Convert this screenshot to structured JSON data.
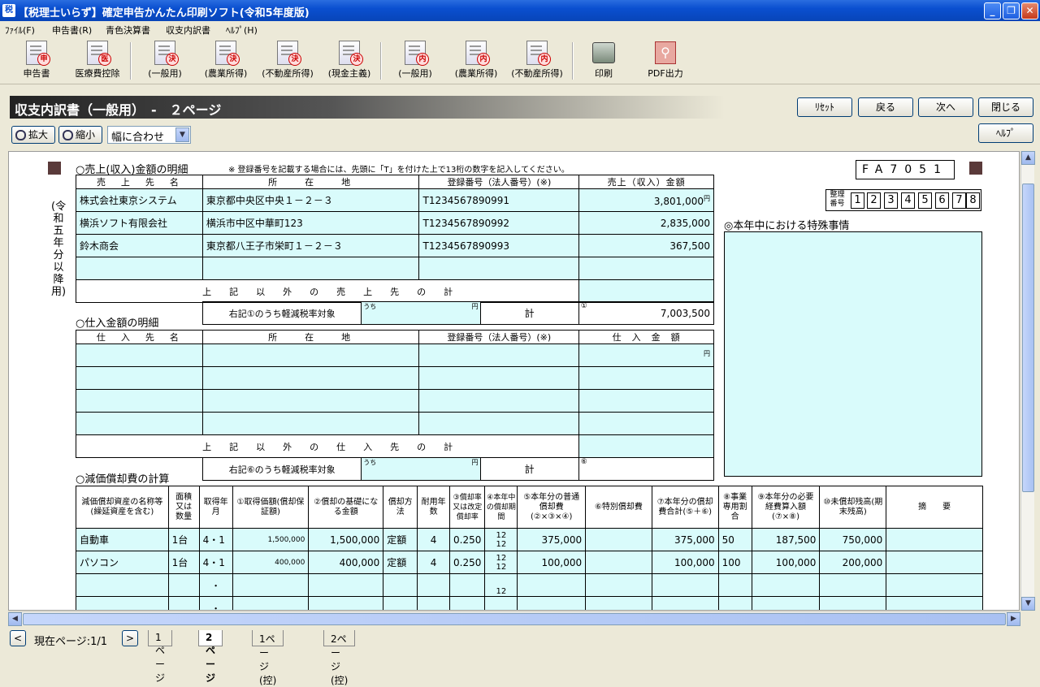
{
  "window": {
    "title": "【税理士いらず】確定申告かんたん印刷ソフト(令和5年度版)",
    "app_icon": "税",
    "minimize": "_",
    "maximize": "❐",
    "close": "✕"
  },
  "menu": [
    "ﾌｧｲﾙ(F)",
    "申告書(R)",
    "青色決算書",
    "収支内訳書",
    "ﾍﾙﾌﾟ(H)"
  ],
  "toolbar": {
    "shinkoku": {
      "label": "申告書",
      "stamp": "申"
    },
    "iryo": {
      "label": "医療費控除",
      "stamp": "医"
    },
    "ketsu_ippan": {
      "label": "(一般用)",
      "stamp": "決"
    },
    "ketsu_nogyo": {
      "label": "(農業所得)",
      "stamp": "決"
    },
    "ketsu_fudosan": {
      "label": "(不動産所得)",
      "stamp": "決"
    },
    "ketsu_genkin": {
      "label": "(現金主義)",
      "stamp": "決"
    },
    "uchi_ippan": {
      "label": "(一般用)",
      "stamp": "内"
    },
    "uchi_nogyo": {
      "label": "(農業所得)",
      "stamp": "内"
    },
    "uchi_fudosan": {
      "label": "(不動産所得)",
      "stamp": "内"
    },
    "print": {
      "label": "印刷"
    },
    "pdf": {
      "label": "PDF出力"
    }
  },
  "header": {
    "title": "収支内訳書（一般用）　-　２ページ"
  },
  "nav": {
    "reset": "ﾘｾｯﾄ",
    "prev": "戻る",
    "next": "次へ",
    "close": "閉じる",
    "help": "ﾍﾙﾌﾟ"
  },
  "zoom": {
    "in": "拡大",
    "out": "縮小",
    "fit": "幅に合わせ"
  },
  "form": {
    "code": "FA7051",
    "seiri_label": "整理番号",
    "seiri_digits": [
      "1",
      "2",
      "3",
      "4",
      "5",
      "6",
      "7",
      "8"
    ],
    "vertical_note": "(令和五年分以降用)",
    "sales": {
      "title": "○売上(収入)金額の明細",
      "note": "※ 登録番号を記載する場合には、先頭に「T」を付けた上で13桁の数字を記入してください。",
      "headers": [
        "売　上　先　名",
        "所　　在　　地",
        "登録番号（法人番号）(※)",
        "売上（収入）金額"
      ],
      "rows": [
        {
          "name": "株式会社東京システム",
          "address": "東京都中央区中央１－２－３",
          "reg": "T1234567890991",
          "amount": "3,801,000"
        },
        {
          "name": "横浜ソフト有限会社",
          "address": "横浜市中区中華町123",
          "reg": "T1234567890992",
          "amount": "2,835,000"
        },
        {
          "name": "鈴木商会",
          "address": "東京都八王子市栄町１－２－３",
          "reg": "T1234567890993",
          "amount": "367,500"
        }
      ],
      "other_label": "上　　記　　以　　外　　の　　売　　上　　先　　の　　計",
      "reduced_label": "右記①のうち軽減税率対象",
      "uchi": "うち",
      "yen": "円",
      "total_label": "計",
      "total_mark": "①",
      "total": "7,003,500"
    },
    "special": {
      "title": "◎本年中における特殊事情"
    },
    "purchase": {
      "title": "○仕入金額の明細",
      "headers": [
        "仕　入　先　名",
        "所　　在　　地",
        "登録番号（法人番号）(※)",
        "仕　入　金　額"
      ],
      "other_label": "上　　記　　以　　外　　の　　仕　　入　　先　　の　　計",
      "reduced_label": "右記⑥のうち軽減税率対象",
      "uchi": "うち",
      "yen": "円",
      "total_label": "計",
      "total_mark": "⑥"
    },
    "depreciation": {
      "title": "○減価償却費の計算",
      "headers": {
        "asset": "減価償却資産の名称等(繰延資産を含む)",
        "qty": "面積又は数量",
        "acq": "取得年月",
        "cost": "①取得価額(償却保証額)",
        "base": "②償却の基礎になる金額",
        "method": "償却方法",
        "life": "耐用年数",
        "rate": "③償却率又は改定償却率",
        "period": "④本年中の償却期間",
        "normal": "⑤本年分の普通償却費(②×③×④)",
        "special": "⑥特別償却費",
        "total": "⑦本年分の償却費合計(⑤＋⑥)",
        "biz": "⑧事業専用割合",
        "expense": "⑨本年分の必要経費算入額(⑦×⑧)",
        "remain": "⑩未償却残高(期末残高)",
        "memo": "摘　　要"
      },
      "rows": [
        {
          "asset": "自動車",
          "qty": "1台",
          "acq": "4・1",
          "cost": "1,500,000",
          "base": "1,500,000",
          "method": "定額",
          "life": "4",
          "rate": "0.250",
          "period_num": "12",
          "period_den": "12",
          "normal": "375,000",
          "total": "375,000",
          "biz": "50",
          "expense": "187,500",
          "remain": "750,000"
        },
        {
          "asset": "パソコン",
          "qty": "1台",
          "acq": "4・1",
          "cost": "400,000",
          "base": "400,000",
          "method": "定額",
          "life": "4",
          "rate": "0.250",
          "period_num": "12",
          "period_den": "12",
          "normal": "100,000",
          "total": "100,000",
          "biz": "100",
          "expense": "100,000",
          "remain": "200,000"
        }
      ],
      "empty_period_den": "12",
      "year_mark": "年",
      "month_mark": "月",
      "pct": "%"
    }
  },
  "status": {
    "page": "現在ページ:1/1",
    "tabs": [
      "1ページ",
      "2ページ",
      "1ページ(控)",
      "2ページ(控)"
    ]
  }
}
